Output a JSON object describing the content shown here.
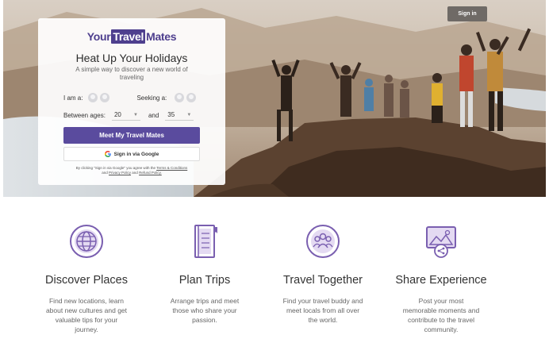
{
  "header": {
    "signin_label": "Sign in"
  },
  "logo": {
    "part1": "Your",
    "part2": "Travel",
    "part3": "Mates"
  },
  "card": {
    "headline": "Heat Up Your Holidays",
    "subline": "A simple way to discover a new world of traveling",
    "i_am_label": "I am a:",
    "seeking_label": "Seeking a:",
    "between_label": "Between ages:",
    "age_from": "20",
    "and_label": "and",
    "age_to": "35",
    "cta_label": "Meet My Travel Mates",
    "google_label": "Sign in via Google",
    "legal_text_1": "By clicking \"Sign in via Google\" you agree with the",
    "legal_terms": "Terms & Conditions",
    "legal_and": "and",
    "legal_privacy": "Privacy Policy",
    "legal_and2": "and",
    "legal_refund": "Refund Policy."
  },
  "features": [
    {
      "title": "Discover Places",
      "desc": "Find new locations, learn about new cultures and get valuable tips for your journey.",
      "icon": "globe-icon"
    },
    {
      "title": "Plan Trips",
      "desc": "Arrange trips and meet those who share your passion.",
      "icon": "notebook-icon"
    },
    {
      "title": "Travel Together",
      "desc": "Find your travel buddy and meet locals from all over the world.",
      "icon": "group-icon"
    },
    {
      "title": "Share Experience",
      "desc": "Post your most memorable moments and contribute to the travel community.",
      "icon": "share-photo-icon"
    }
  ],
  "colors": {
    "brand": "#5a4b9e",
    "icon": "#7a5fb0"
  }
}
